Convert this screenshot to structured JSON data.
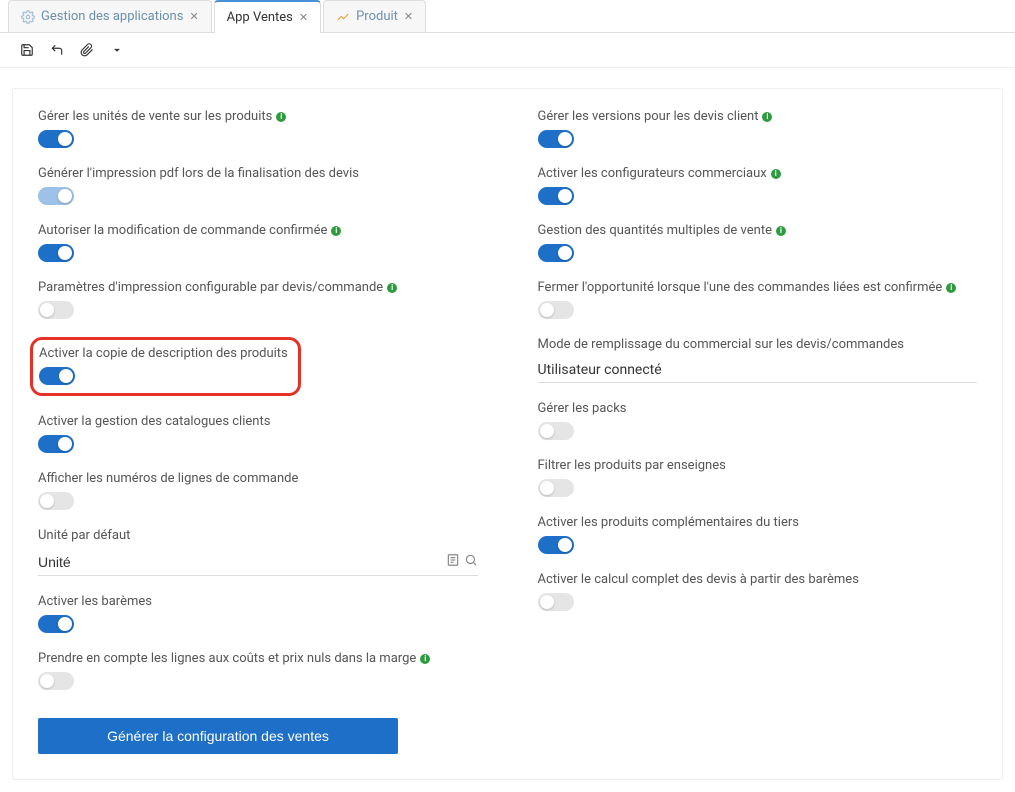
{
  "tabs": [
    {
      "label": "Gestion des applications",
      "icon": "gear",
      "active": false
    },
    {
      "label": "App Ventes",
      "icon": "",
      "active": true
    },
    {
      "label": "Produit",
      "icon": "chart",
      "active": false
    }
  ],
  "left_settings": [
    {
      "key": "units",
      "label": "Gérer les unités de vente sur les produits",
      "info": true,
      "state": "on",
      "disabled": false
    },
    {
      "key": "pdf",
      "label": "Générer l'impression pdf lors de la finalisation des devis",
      "info": false,
      "state": "on",
      "disabled": true
    },
    {
      "key": "confirm",
      "label": "Autoriser la modification de commande confirmée",
      "info": true,
      "state": "on",
      "disabled": false
    },
    {
      "key": "printcfg",
      "label": "Paramètres d'impression configurable par devis/commande",
      "info": true,
      "state": "off",
      "disabled": false
    },
    {
      "key": "copydesc",
      "label": "Activer la copie de description des produits",
      "info": false,
      "state": "on",
      "disabled": false,
      "highlight": true
    },
    {
      "key": "catalog",
      "label": "Activer la gestion des catalogues clients",
      "info": false,
      "state": "on",
      "disabled": false
    },
    {
      "key": "linenum",
      "label": "Afficher les numéros de lignes de commande",
      "info": false,
      "state": "off",
      "disabled": false
    }
  ],
  "unit_default": {
    "label": "Unité par défaut",
    "value": "Unité"
  },
  "left_settings2": [
    {
      "key": "baremes",
      "label": "Activer les barèmes",
      "info": false,
      "state": "on",
      "disabled": false
    },
    {
      "key": "marge",
      "label": "Prendre en compte les lignes aux coûts et prix nuls dans la marge",
      "info": true,
      "state": "off",
      "disabled": false
    }
  ],
  "right_settings": [
    {
      "key": "versions",
      "label": "Gérer les versions pour les devis client",
      "info": true,
      "state": "on",
      "disabled": false
    },
    {
      "key": "configurators",
      "label": "Activer les configurateurs commerciaux",
      "info": true,
      "state": "on",
      "disabled": false
    },
    {
      "key": "multiqty",
      "label": "Gestion des quantités multiples de vente",
      "info": true,
      "state": "on",
      "disabled": false
    },
    {
      "key": "closeopp",
      "label": "Fermer l'opportunité lorsque l'une des commandes liées est confirmée",
      "info": true,
      "state": "off",
      "disabled": false
    }
  ],
  "mode_remplissage": {
    "label": "Mode de remplissage du commercial sur les devis/commandes",
    "value": "Utilisateur connecté"
  },
  "right_settings2": [
    {
      "key": "packs",
      "label": "Gérer les packs",
      "info": false,
      "state": "off",
      "disabled": false
    },
    {
      "key": "filter",
      "label": "Filtrer les produits par enseignes",
      "info": false,
      "state": "off",
      "disabled": false
    },
    {
      "key": "compl",
      "label": "Activer les produits complémentaires du tiers",
      "info": false,
      "state": "on",
      "disabled": false
    },
    {
      "key": "calc",
      "label": "Activer le calcul complet des devis à partir des barèmes",
      "info": false,
      "state": "off",
      "disabled": false
    }
  ],
  "generate_button": "Générer la configuration des ventes"
}
